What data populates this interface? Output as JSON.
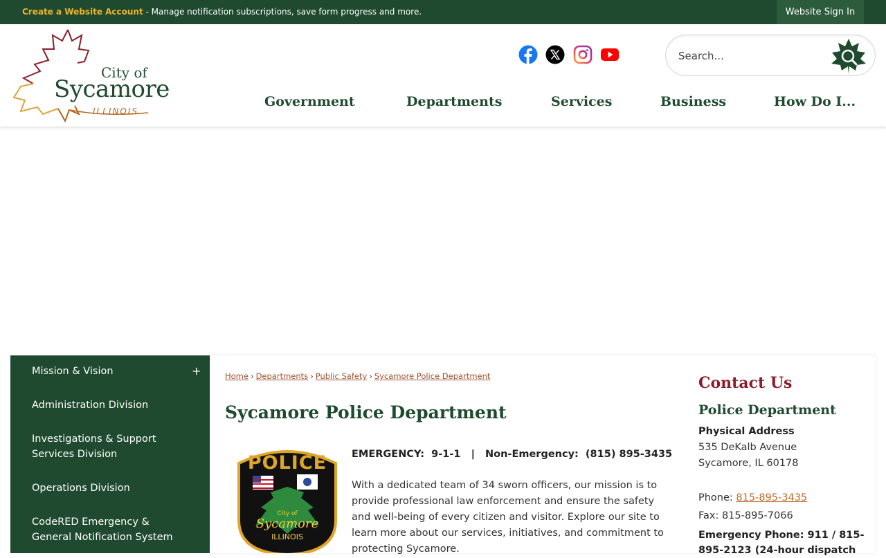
{
  "topbar": {
    "create_account": "Create a Website Account",
    "create_account_desc": " - Manage notification subscriptions, save form progress and more.",
    "sign_in": "Website Sign In"
  },
  "logo": {
    "city_of": "City of",
    "name": "Sycamore",
    "state": "ILLINOIS"
  },
  "social": [
    {
      "icon": "facebook-icon",
      "color": "#1877f2"
    },
    {
      "icon": "x-twitter-icon",
      "color": "#000000"
    },
    {
      "icon": "instagram-icon",
      "color": "#c13584"
    },
    {
      "icon": "youtube-icon",
      "color": "#ff0000"
    }
  ],
  "search": {
    "placeholder": "Search..."
  },
  "nav": [
    "Government",
    "Departments",
    "Services",
    "Business",
    "How Do I..."
  ],
  "sidebar": {
    "items": [
      {
        "label": "Mission & Vision",
        "expand": "+"
      },
      {
        "label": "Administration Division"
      },
      {
        "label": "Investigations & Support Services Division"
      },
      {
        "label": "Operations Division"
      },
      {
        "label": "CodeRED Emergency & General Notification System"
      }
    ]
  },
  "breadcrumb": [
    "Home",
    "Departments",
    "Public Safety",
    "Sycamore Police Department"
  ],
  "breadcrumb_sep": "›",
  "main": {
    "title": "Sycamore Police Department",
    "badge": {
      "top": "POLICE",
      "city_of": "City of",
      "name": "Sycamore",
      "state": "ILLINOIS"
    },
    "emergency_line": "EMERGENCY:  9-1-1   |   Non-Emergency:  (815) 895-3435",
    "body": "With a dedicated team of 34 sworn officers, our mission is to provide professional law enforcement and ensure the safety and well-being of every citizen and visitor.  Explore our site to learn more about our services, initiatives, and commitment to protecting Sycamore."
  },
  "contact": {
    "title": "Contact Us",
    "dept": "Police Department",
    "address_label": "Physical Address",
    "address_1": "535 DeKalb Avenue",
    "address_2": "Sycamore, IL 60178",
    "phone_label": "Phone: ",
    "phone": "815-895-3435",
    "fax": "Fax: 815-895-7066",
    "emergency": "Emergency Phone: 911 / 815-895-2123 (24-hour dispatch"
  },
  "colors": {
    "brand_green": "#1f4a2f",
    "accent_gold": "#f0b429",
    "contact_red": "#8b1e2b",
    "link_orange": "#c0692a"
  }
}
